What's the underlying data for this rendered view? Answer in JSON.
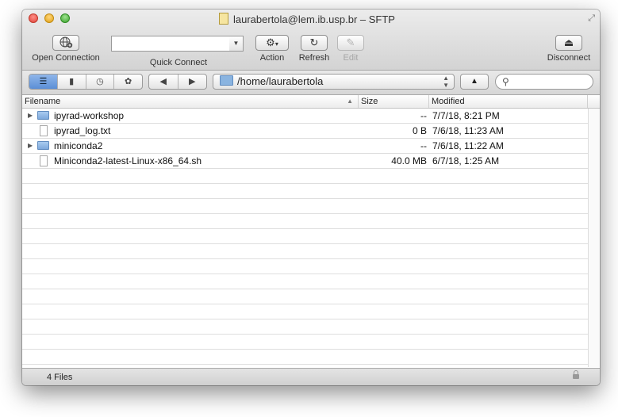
{
  "window": {
    "title": "laurabertola@lem.ib.usp.br – SFTP"
  },
  "toolbar": {
    "open_connection": "Open Connection",
    "quick_connect": "Quick Connect",
    "quick_connect_value": "",
    "action": "Action",
    "refresh": "Refresh",
    "edit": "Edit",
    "disconnect": "Disconnect"
  },
  "navbar": {
    "path": "/home/laurabertola",
    "search_value": ""
  },
  "columns": {
    "filename": "Filename",
    "size": "Size",
    "modified": "Modified"
  },
  "files": [
    {
      "name": "ipyrad-workshop",
      "type": "folder",
      "size": "--",
      "modified": "7/7/18, 8:21 PM"
    },
    {
      "name": "ipyrad_log.txt",
      "type": "file",
      "size": "0 B",
      "modified": "7/6/18, 11:23 AM"
    },
    {
      "name": "miniconda2",
      "type": "folder",
      "size": "--",
      "modified": "7/6/18, 11:22 AM"
    },
    {
      "name": "Miniconda2-latest-Linux-x86_64.sh",
      "type": "file",
      "size": "40.0 MB",
      "modified": "6/7/18, 1:25 AM"
    }
  ],
  "status": {
    "text": "4 Files"
  },
  "icons": {
    "open_connection": "globe-plus-icon",
    "action": "gear-icon",
    "refresh": "refresh-icon",
    "edit": "pencil-icon",
    "disconnect": "eject-icon",
    "lock": "lock-icon"
  }
}
